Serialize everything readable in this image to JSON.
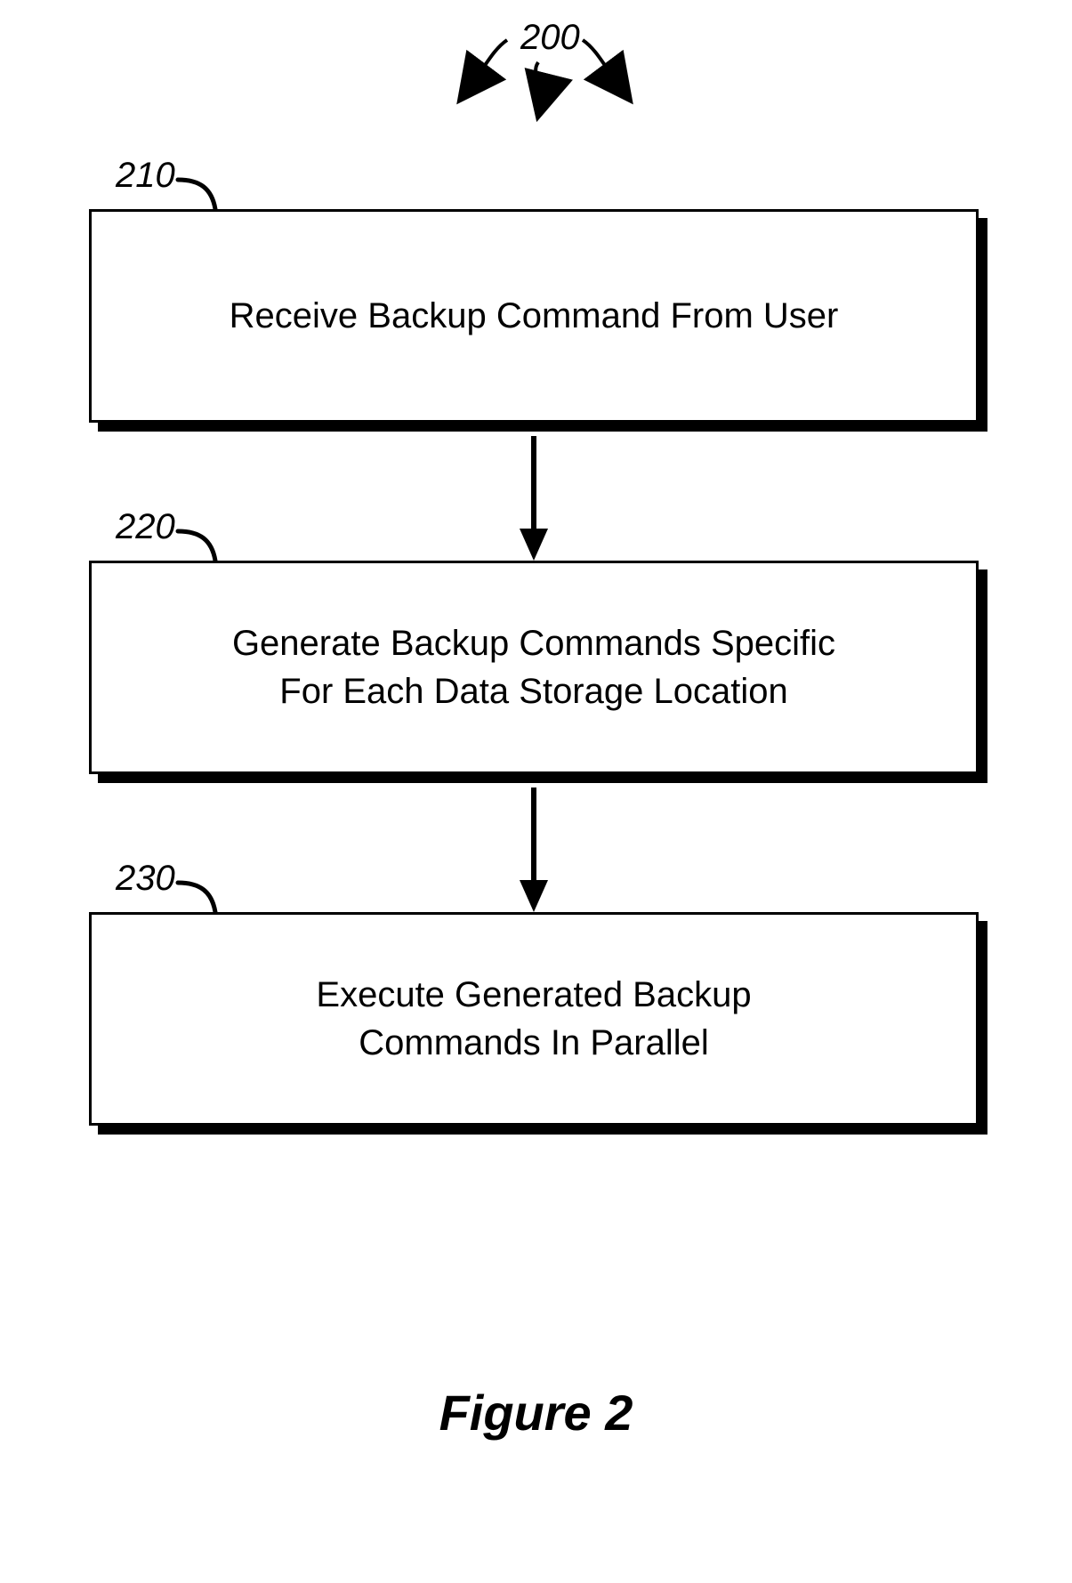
{
  "figure": {
    "title": "Figure 2",
    "top_ref": "200"
  },
  "steps": [
    {
      "id": "200",
      "text": ""
    },
    {
      "id": "210",
      "text": "Receive Backup Command From User"
    },
    {
      "id": "220",
      "text": "Generate Backup Commands Specific\nFor Each Data Storage Location"
    },
    {
      "id": "230",
      "text": "Execute Generated Backup\nCommands In Parallel"
    }
  ],
  "labels": {
    "s210": "210",
    "s220": "220",
    "s230": "230"
  }
}
